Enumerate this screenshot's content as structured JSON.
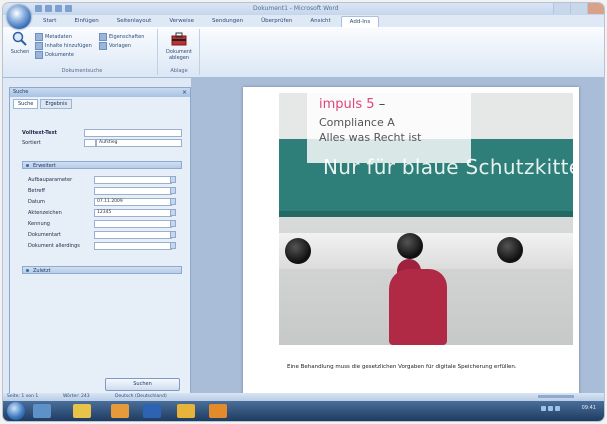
{
  "window": {
    "title": "Dokument1 - Microsoft Word"
  },
  "ribbon_tabs": [
    "Start",
    "Einfügen",
    "Seitenlayout",
    "Verweise",
    "Sendungen",
    "Überprüfen",
    "Ansicht",
    "Add-Ins"
  ],
  "ribbon": {
    "search_label": "Suchen",
    "small1": "Metadaten",
    "small2": "Inhalte hinzufügen",
    "small3": "Dokumente",
    "small4": "Eigenschaften",
    "small5": "Vorlagen",
    "group1_label": "Dokumentsuche",
    "big2_label": "Dokument ablegen",
    "group2_label": "Ablage"
  },
  "pane": {
    "title": "Suche",
    "tabs": [
      "Suche",
      "Ergebnis"
    ],
    "fulltext_label": "Volltext-Text",
    "sort_label": "Sortiert",
    "sort_value": "Aufstieg",
    "section1": "Erweitert",
    "fields": [
      {
        "label": "Aufbauparameter",
        "value": ""
      },
      {
        "label": "Betreff",
        "value": ""
      },
      {
        "label": "Datum",
        "value": "07.11.2009"
      },
      {
        "label": "Aktenzeichen",
        "value": "12345"
      },
      {
        "label": "Kennung",
        "value": ""
      },
      {
        "label": "Dokumentart",
        "value": ""
      },
      {
        "label": "Dokument allerdings",
        "value": ""
      }
    ],
    "section2": "Zuletzt",
    "search_button": "Suchen"
  },
  "document": {
    "impuls_word": "impuls 5",
    "dash": " –",
    "subtitle1": "Compliance A",
    "subtitle2": "Alles was Recht ist",
    "headline": "Nur für blaue Schutzkittel",
    "body": "Eine Beha­ndlung muss die gesetzlichen Vorgaben für digitale Speicherung erfüllen."
  },
  "status": {
    "page": "Seite: 1 von 1",
    "words": "Wörter: 243",
    "lang": "Deutsch (Deutschland)"
  },
  "taskbar": {
    "clock": "09:41"
  },
  "colors": {
    "accent": "#2e7f79",
    "impuls": "#e0447a",
    "coat": "#b02a46"
  }
}
